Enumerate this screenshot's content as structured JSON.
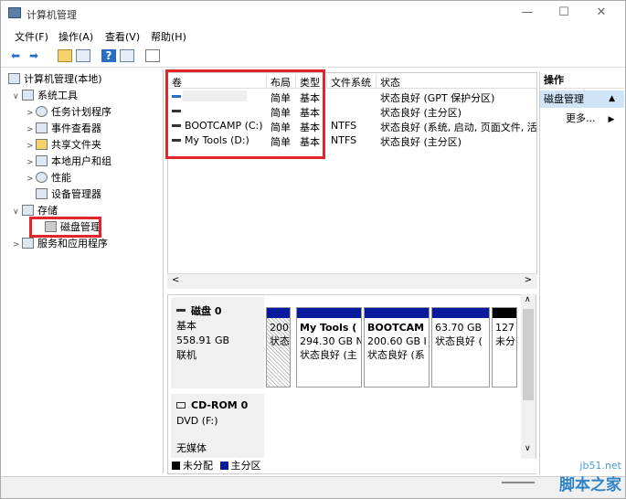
{
  "window": {
    "title": "计算机管理",
    "min": "—",
    "max": "☐",
    "close": "✕"
  },
  "menu": [
    "文件(F)",
    "操作(A)",
    "查看(V)",
    "帮助(H)"
  ],
  "tree": {
    "root": "计算机管理(本地)",
    "system_tools": "系统工具",
    "task_scheduler": "任务计划程序",
    "event_viewer": "事件查看器",
    "shared_folders": "共享文件夹",
    "local_users": "本地用户和组",
    "performance": "性能",
    "device_manager": "设备管理器",
    "storage": "存储",
    "disk_management": "磁盘管理",
    "services_apps": "服务和应用程序"
  },
  "volume_table": {
    "headers": [
      "卷",
      "布局",
      "类型",
      "文件系统",
      "状态"
    ],
    "rows": [
      {
        "vol": "",
        "layout": "简单",
        "type": "基本",
        "fs": "",
        "status": "状态良好 (GPT 保护分区)"
      },
      {
        "vol": "",
        "layout": "简单",
        "type": "基本",
        "fs": "",
        "status": "状态良好 (主分区)"
      },
      {
        "vol": "BOOTCAMP (C:)",
        "layout": "简单",
        "type": "基本",
        "fs": "NTFS",
        "status": "状态良好 (系统, 启动, 页面文件, 活动"
      },
      {
        "vol": "My Tools (D:)",
        "layout": "简单",
        "type": "基本",
        "fs": "NTFS",
        "status": "状态良好 (主分区)"
      }
    ]
  },
  "disk0": {
    "name": "磁盘 0",
    "kind": "基本",
    "size": "558.91 GB",
    "state": "联机",
    "partitions": [
      {
        "l1": "",
        "l2": "200",
        "l3": "状态"
      },
      {
        "l1": "My Tools (",
        "l2": "294.30 GB N",
        "l3": "状态良好 (主"
      },
      {
        "l1": "BOOTCAM",
        "l2": "200.60 GB I",
        "l3": "状态良好 (系"
      },
      {
        "l1": "",
        "l2": "63.70 GB",
        "l3": "状态良好 ("
      },
      {
        "l1": "",
        "l2": "127",
        "l3": "未分"
      }
    ]
  },
  "cdrom": {
    "name": "CD-ROM 0",
    "drive": "DVD (F:)",
    "media": "无媒体"
  },
  "legend": {
    "unallocated": "未分配",
    "primary": "主分区",
    "unallocated_color": "#000000",
    "primary_color": "#0a1a9c"
  },
  "actions": {
    "header": "操作",
    "selected": "磁盘管理",
    "more": "更多..."
  },
  "watermark": {
    "site": "jb51.net",
    "name": "脚本之家"
  }
}
